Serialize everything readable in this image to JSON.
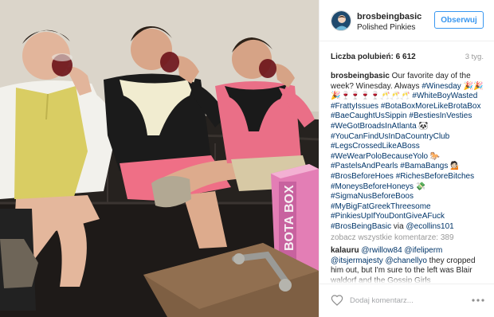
{
  "post": {
    "username": "brosbeingbasic",
    "location": "Polished Pinkies",
    "follow_label": "Obserwuj",
    "likes_text": "Liczba polubień: 6 612",
    "time_ago": "3 tyg.",
    "caption": {
      "username": "brosbeingbasic",
      "text_intro": " Our favorite day of the week? Winesday. Always ",
      "hashtags_emoji_line": [
        {
          "tag": "#Winesday",
          "emoji": " 🎉🎉🎉🍷🍷🍷🍷🥂🥂🥂"
        }
      ],
      "hashtags": [
        {
          "tag": "#WhiteBoyWasted",
          "sep": " "
        },
        {
          "tag": "#FrattyIssues",
          "sep": " "
        },
        {
          "tag": "#BotaBoxMoreLikeBrotaBox",
          "sep": " "
        },
        {
          "tag": "#BaeCaughtUsSippin",
          "sep": " "
        },
        {
          "tag": "#BestiesInVesties",
          "sep": " "
        },
        {
          "tag": "#WeGotBroadsInAtlanta",
          "sep": " 🐼 "
        },
        {
          "tag": "#YouCanFindUsInDaCountryClub",
          "sep": " "
        },
        {
          "tag": "#LegsCrossedLikeABoss",
          "sep": " "
        },
        {
          "tag": "#WeWearPoloBecauseYolo",
          "sep": " 🐎 "
        },
        {
          "tag": "#PastelsAndPearls",
          "sep": " "
        },
        {
          "tag": "#BamaBangs",
          "sep": " 💁🏻 "
        },
        {
          "tag": "#BrosBeforeHoes",
          "sep": " "
        },
        {
          "tag": "#RichesBeforeBitches",
          "sep": " "
        },
        {
          "tag": "#MoneysBeforeHoneys",
          "sep": " 💸 "
        },
        {
          "tag": "#SigmaNusBeforeBoos",
          "sep": " "
        },
        {
          "tag": "#MyBigFatGreekThreesome",
          "sep": " "
        },
        {
          "tag": "#PinkiesUpIfYouDontGiveAFuck",
          "sep": " "
        },
        {
          "tag": "#BrosBeingBasic",
          "sep": ""
        }
      ],
      "via_text": " via ",
      "via_user": "@ecollins101"
    },
    "view_all_comments": "zobacz wszystkie komentarze: 389",
    "comment": {
      "username": "kalauru",
      "mentions": [
        "@rwillow84",
        "@ifeliperm",
        "@itsjermajesty",
        "@chanellyo"
      ],
      "text": " they cropped him out, but I'm sure to the left was Blair waldorf and the Gossip Girls"
    },
    "comment_placeholder": "Dodaj komentarz...",
    "icons": {
      "avatar": "brand-avatar-icon",
      "like": "heart-icon",
      "more": "ellipsis-icon"
    },
    "colors": {
      "accent": "#3897f0",
      "hashtag": "#003569",
      "muted": "#999999"
    },
    "photo": {
      "box_brand": "BOTA BOX"
    }
  }
}
